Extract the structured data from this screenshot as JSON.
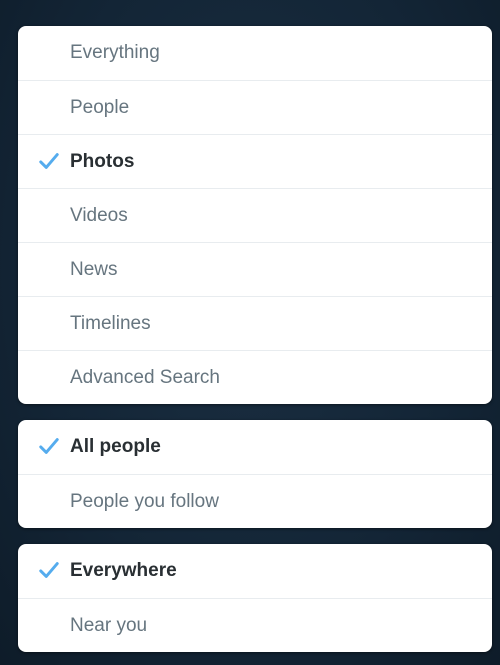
{
  "accent_color": "#55acee",
  "groups": [
    {
      "items": [
        {
          "label": "Everything",
          "selected": false
        },
        {
          "label": "People",
          "selected": false
        },
        {
          "label": "Photos",
          "selected": true,
          "icon": "checkmark-icon"
        },
        {
          "label": "Videos",
          "selected": false
        },
        {
          "label": "News",
          "selected": false
        },
        {
          "label": "Timelines",
          "selected": false
        },
        {
          "label": "Advanced Search",
          "selected": false
        }
      ]
    },
    {
      "items": [
        {
          "label": "All people",
          "selected": true,
          "icon": "checkmark-icon"
        },
        {
          "label": "People you follow",
          "selected": false
        }
      ]
    },
    {
      "items": [
        {
          "label": "Everywhere",
          "selected": true,
          "icon": "checkmark-icon"
        },
        {
          "label": "Near you",
          "selected": false
        }
      ]
    }
  ]
}
